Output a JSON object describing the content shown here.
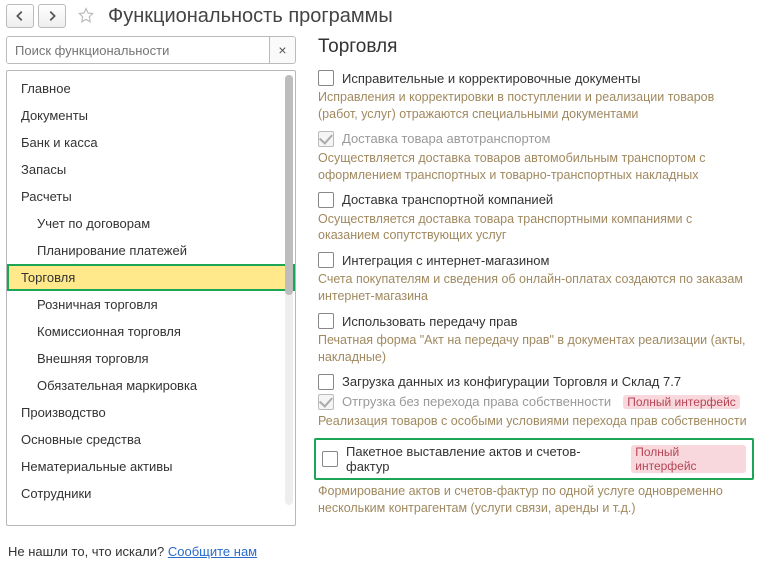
{
  "header": {
    "title": "Функциональность программы"
  },
  "search": {
    "placeholder": "Поиск функциональности",
    "clear": "×"
  },
  "sidebar": {
    "items": [
      {
        "label": "Главное",
        "child": false,
        "selected": false
      },
      {
        "label": "Документы",
        "child": false,
        "selected": false
      },
      {
        "label": "Банк и касса",
        "child": false,
        "selected": false
      },
      {
        "label": "Запасы",
        "child": false,
        "selected": false
      },
      {
        "label": "Расчеты",
        "child": false,
        "selected": false
      },
      {
        "label": "Учет по договорам",
        "child": true,
        "selected": false
      },
      {
        "label": "Планирование платежей",
        "child": true,
        "selected": false
      },
      {
        "label": "Торговля",
        "child": true,
        "selected": true
      },
      {
        "label": "Розничная торговля",
        "child": true,
        "selected": false
      },
      {
        "label": "Комиссионная торговля",
        "child": true,
        "selected": false
      },
      {
        "label": "Внешняя торговля",
        "child": true,
        "selected": false
      },
      {
        "label": "Обязательная маркировка",
        "child": true,
        "selected": false
      },
      {
        "label": "Производство",
        "child": false,
        "selected": false
      },
      {
        "label": "Основные средства",
        "child": false,
        "selected": false
      },
      {
        "label": "Нематериальные активы",
        "child": false,
        "selected": false
      },
      {
        "label": "Сотрудники",
        "child": false,
        "selected": false
      }
    ]
  },
  "section": {
    "title": "Торговля",
    "options": [
      {
        "label": "Исправительные и корректировочные документы",
        "disabled": false,
        "checked": false,
        "badge": "",
        "desc": "Исправления и корректировки в поступлении и реализации товаров (работ, услуг) отражаются специальными документами",
        "highlight": false
      },
      {
        "label": "Доставка товара автотранспортом",
        "disabled": true,
        "checked": true,
        "badge": "",
        "desc": "Осуществляется доставка товаров автомобильным транспортом с оформлением транспортных и товарно-транспортных накладных",
        "highlight": false
      },
      {
        "label": "Доставка транспортной компанией",
        "disabled": false,
        "checked": false,
        "badge": "",
        "desc": "Осуществляется доставка товара транспортными компаниями с оказанием сопутствующих услуг",
        "highlight": false
      },
      {
        "label": "Интеграция с интернет-магазином",
        "disabled": false,
        "checked": false,
        "badge": "",
        "desc": "Счета покупателям и сведения об онлайн-оплатах создаются по заказам интернет-магазина",
        "highlight": false
      },
      {
        "label": "Использовать передачу прав",
        "disabled": false,
        "checked": false,
        "badge": "",
        "desc": "Печатная форма \"Акт на передачу прав\" в документах реализации (акты, накладные)",
        "highlight": false
      },
      {
        "label": "Загрузка данных из конфигурации Торговля и Склад 7.7",
        "disabled": false,
        "checked": false,
        "badge": "",
        "desc": "",
        "highlight": false
      },
      {
        "label": "Отгрузка без перехода права собственности",
        "disabled": true,
        "checked": true,
        "badge": "Полный интерфейс",
        "desc": "Реализация товаров с особыми условиями перехода прав собственности",
        "highlight": false
      },
      {
        "label": "Пакетное выставление актов и счетов-фактур",
        "disabled": false,
        "checked": false,
        "badge": "Полный интерфейс",
        "desc": "Формирование актов и счетов-фактур по одной услуге одновременно нескольким контрагентам (услуги связи, аренды и т.д.)",
        "highlight": true
      }
    ]
  },
  "footer": {
    "text": "Не нашли то, что искали? ",
    "link": "Сообщите нам"
  }
}
